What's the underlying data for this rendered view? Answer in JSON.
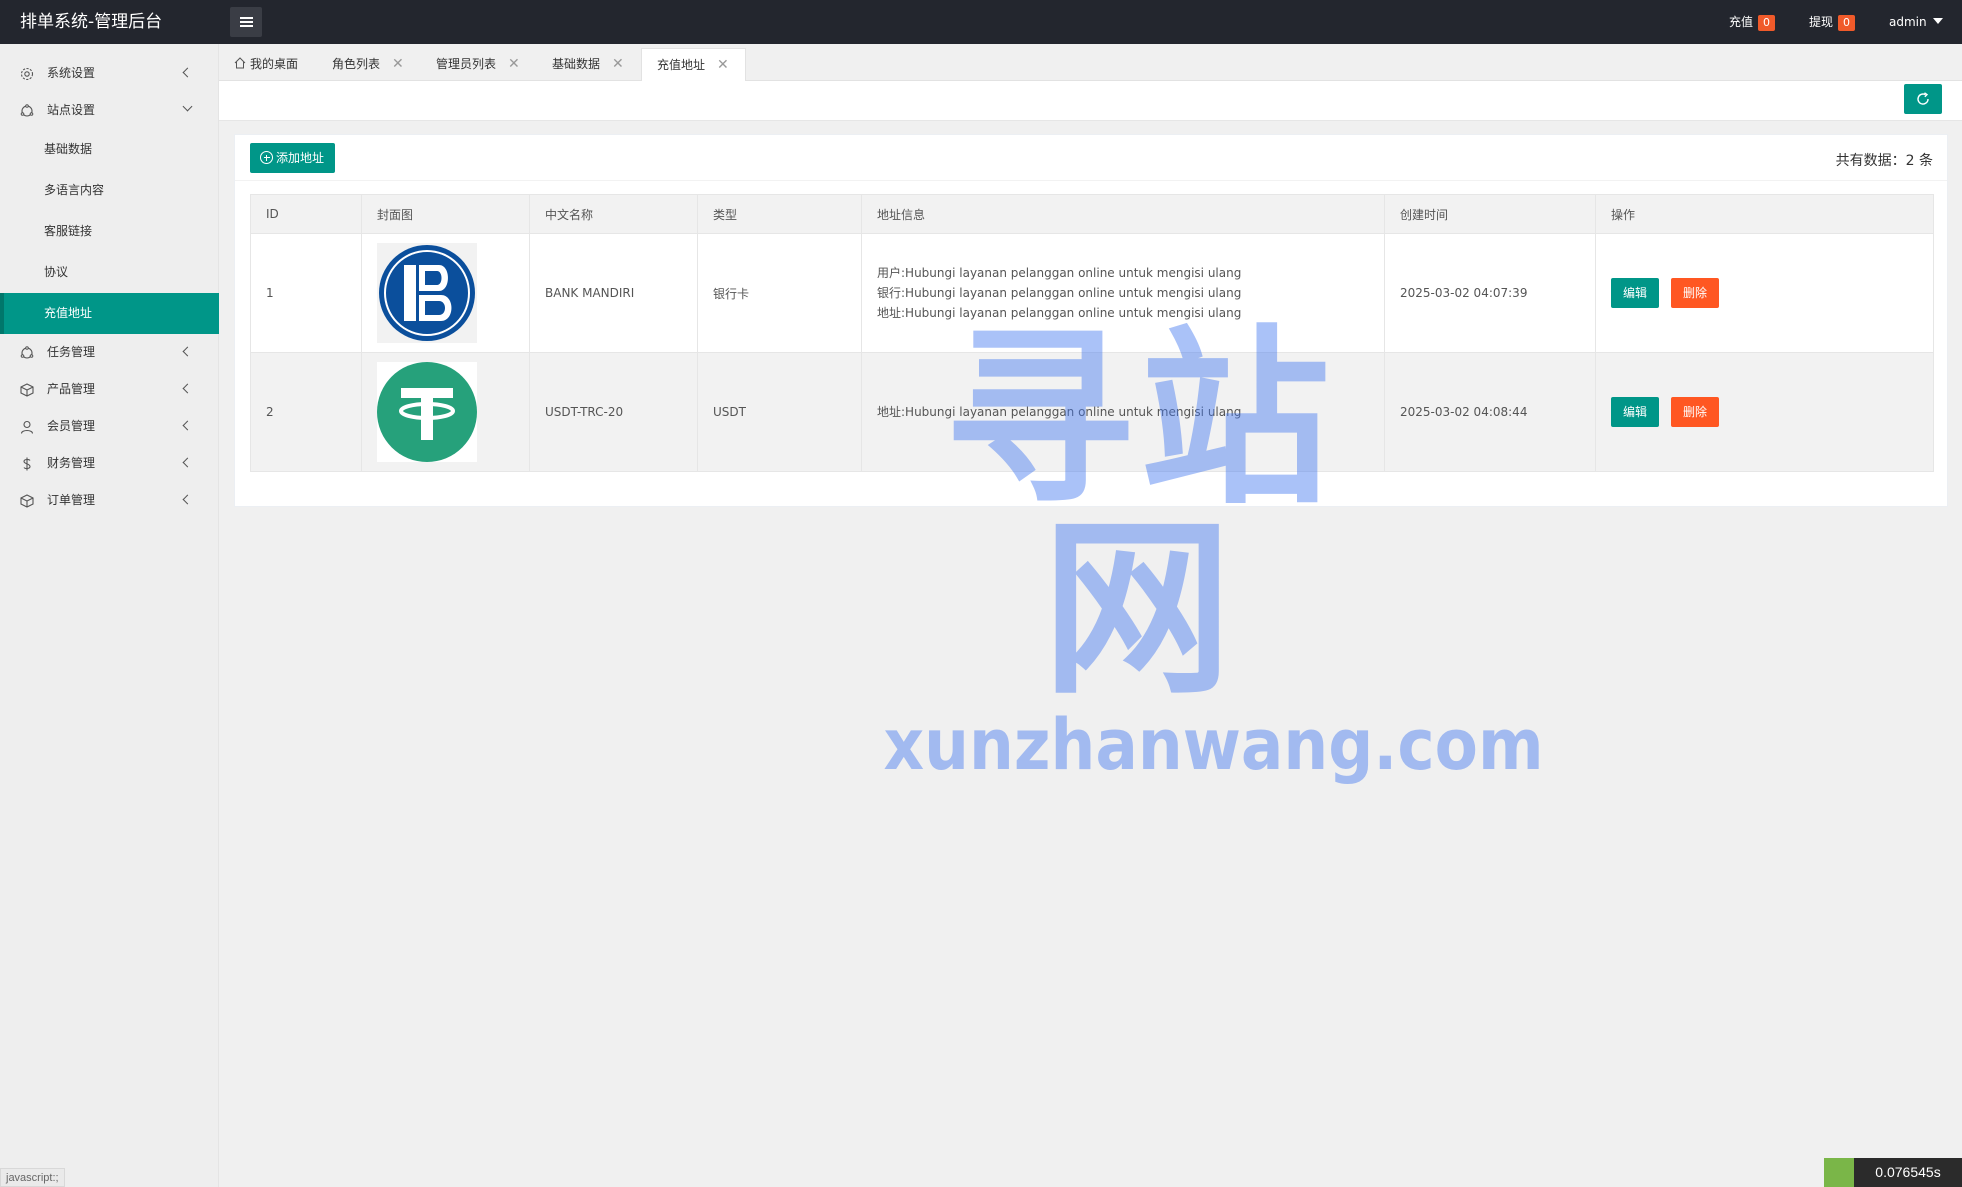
{
  "app": {
    "title": "排单系统-管理后台"
  },
  "header": {
    "recharge_label": "充值",
    "recharge_count": "0",
    "withdraw_label": "提现",
    "withdraw_count": "0",
    "user": "admin"
  },
  "sidebar": {
    "items": [
      {
        "label": "系统设置",
        "icon": "gear-icon"
      },
      {
        "label": "站点设置",
        "icon": "site-icon"
      },
      {
        "label": "任务管理",
        "icon": "task-icon"
      },
      {
        "label": "产品管理",
        "icon": "product-icon"
      },
      {
        "label": "会员管理",
        "icon": "user-icon"
      },
      {
        "label": "财务管理",
        "icon": "dollar-icon"
      },
      {
        "label": "订单管理",
        "icon": "order-icon"
      }
    ],
    "sub_items": [
      "基础数据",
      "多语言内容",
      "客服链接",
      "协议",
      "充值地址"
    ]
  },
  "tabs": [
    {
      "label": "我的桌面"
    },
    {
      "label": "角色列表"
    },
    {
      "label": "管理员列表"
    },
    {
      "label": "基础数据"
    },
    {
      "label": "充值地址"
    }
  ],
  "toolbar": {
    "add_label": "添加地址",
    "total_text": "共有数据：2 条"
  },
  "table": {
    "headers": [
      "ID",
      "封面图",
      "中文名称",
      "类型",
      "地址信息",
      "创建时间",
      "操作"
    ],
    "rows": [
      {
        "id": "1",
        "name": "BANK MANDIRI",
        "type": "银行卡",
        "addr": [
          "用户:Hubungi layanan pelanggan online untuk mengisi ulang",
          "银行:Hubungi layanan pelanggan online untuk mengisi ulang",
          "地址:Hubungi layanan pelanggan online untuk mengisi ulang"
        ],
        "created": "2025-03-02 04:07:39"
      },
      {
        "id": "2",
        "name": "USDT-TRC-20",
        "type": "USDT",
        "addr": [
          "地址:Hubungi layanan pelanggan online untuk mengisi ulang"
        ],
        "created": "2025-03-02 04:08:44"
      }
    ],
    "edit_label": "编辑",
    "delete_label": "删除"
  },
  "watermark": {
    "cn": "寻站网",
    "en": "xunzhanwang.com"
  },
  "footer": {
    "status_url": "javascript:;",
    "timer": "0.076545s"
  },
  "colors": {
    "primary": "#009688",
    "danger": "#ff5722",
    "header_bg": "#23262e",
    "badge": "#f05a2a"
  }
}
